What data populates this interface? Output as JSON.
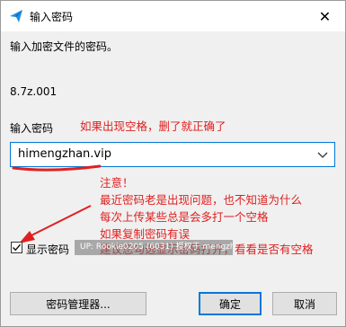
{
  "window": {
    "title": "输入密码",
    "close_glyph": "✕"
  },
  "prompt_text": "输入加密文件的密码。",
  "file_name": "8.7z.001",
  "password_label": "输入密码",
  "password_value": "himengzhan.vip",
  "annotations": {
    "note_top": "如果出现空格，删了就正确了",
    "note_lines": [
      "注意！",
      "最近密码老是出现问题，也不知道为什么",
      "每次上传某些总是会多打一个空格",
      "如果复制密码有误",
      "建议您勾选显示密码打开，看看是否有空格"
    ]
  },
  "show_password": {
    "label": "显示密码",
    "checked": true
  },
  "watermark_text": "UP: Rookie0205 (6031) 授权于 mengzhan.net",
  "buttons": {
    "manager": "密码管理器...",
    "ok": "确定",
    "cancel": "取消"
  },
  "colors": {
    "accent": "#0078d7",
    "annotation_red": "#e02020",
    "icon_blue": "#1e90e6"
  }
}
